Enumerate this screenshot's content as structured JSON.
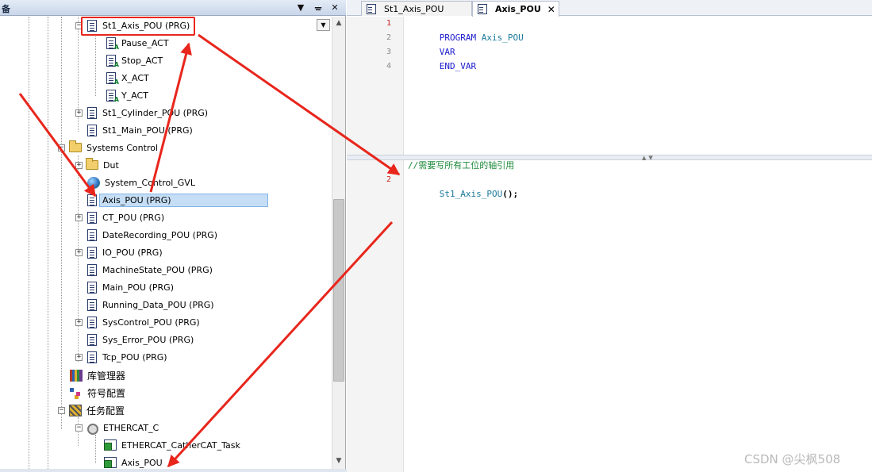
{
  "panel": {
    "title": "备",
    "btn_dropdown": "▼",
    "btn_pin": "ᵖ",
    "btn_close": "✕"
  },
  "tree": {
    "items": [
      {
        "label": "St1_Axis_POU (PRG)"
      },
      {
        "label": "Pause_ACT"
      },
      {
        "label": "Stop_ACT"
      },
      {
        "label": "X_ACT"
      },
      {
        "label": "Y_ACT"
      },
      {
        "label": "St1_Cylinder_POU (PRG)"
      },
      {
        "label": "St1_Main_POU (PRG)"
      },
      {
        "label": "Systems Control"
      },
      {
        "label": "Dut"
      },
      {
        "label": "System_Control_GVL"
      },
      {
        "label": "Axis_POU (PRG)"
      },
      {
        "label": "CT_POU (PRG)"
      },
      {
        "label": "DateRecording_POU (PRG)"
      },
      {
        "label": "IO_POU (PRG)"
      },
      {
        "label": "MachineState_POU (PRG)"
      },
      {
        "label": "Main_POU (PRG)"
      },
      {
        "label": "Running_Data_POU (PRG)"
      },
      {
        "label": "SysControl_POU (PRG)"
      },
      {
        "label": "Sys_Error_POU (PRG)"
      },
      {
        "label": "Tcp_POU (PRG)"
      },
      {
        "label": "库管理器"
      },
      {
        "label": "符号配置"
      },
      {
        "label": "任务配置"
      },
      {
        "label": "ETHERCAT_C"
      },
      {
        "label": "ETHERCAT_CatherCAT_Task"
      },
      {
        "label": "Axis_POU"
      }
    ],
    "expander_plus": "+",
    "expander_minus": "−"
  },
  "editor": {
    "tabs": [
      {
        "label": "St1_Axis_POU",
        "active": false
      },
      {
        "label": "Axis_POU",
        "active": true,
        "close": "✕"
      }
    ],
    "decl": {
      "line_numbers": [
        "1",
        "2",
        "3",
        "4"
      ],
      "program_kw": "PROGRAM",
      "program_name": "Axis_POU",
      "var_kw": "VAR",
      "end_var_kw": "END_VAR"
    },
    "impl": {
      "line_numbers": [
        "2"
      ],
      "comment": "//需要写所有工位的轴引用",
      "call_name": "St1_Axis_POU",
      "call_punct": "();"
    },
    "splitter_arrows": "▲▼"
  },
  "watermark": "CSDN @尖枫508",
  "colors": {
    "highlight": "#e8261c",
    "selected": "#c5def5",
    "keyword": "#1a1acc",
    "identifier": "#1a7a9a",
    "comment": "#1f8a3b"
  },
  "icons": [
    "doc-icon",
    "action-icon",
    "folder-icon",
    "globe-icon",
    "library-icon",
    "symbol-icon",
    "task-config-icon",
    "ethercat-icon",
    "task-icon",
    "close-icon",
    "pin-icon",
    "chevron-down-icon"
  ]
}
